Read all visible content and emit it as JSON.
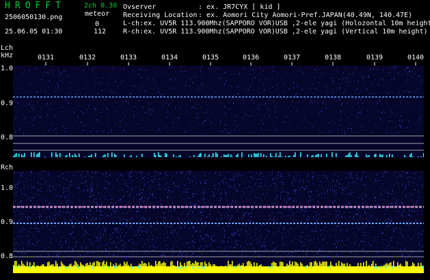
{
  "header": {
    "app_title": "HROFFT",
    "version": "2ch 0.30",
    "filename": "2506050130.png",
    "datetime": "25.06.05 01:30",
    "meteor_label": "meteor",
    "meteor_count_l": "0",
    "meteor_count_r": "112"
  },
  "info": {
    "observer_label": "Ovserver",
    "observer_value": ": ex. JR7CYX [ kid ]",
    "location_label": "Receiving Location",
    "location_value": ": ex. Aomori City Aomori-Pref.JAPAN(40.49N, 140.47E)",
    "lch_info": "L-ch:ex. UV5R 113.900Mhz(SAPPORO VOR)USB ,2-ele yagi (Holozontal 10m height)",
    "rch_info": "R-ch:ex. UV5R 113.900Mhz(SAPPORO VOR)USB ,2-ele yagi (Vertical 10m height)"
  },
  "channels": {
    "lch": "Lch",
    "khz": "kHz",
    "rch": "Rch"
  },
  "time_ticks": [
    "0131",
    "0132",
    "0133",
    "0134",
    "0135",
    "0136",
    "0137",
    "0138",
    "0139",
    "0140"
  ],
  "lch_axis": [
    "1.0",
    "0.9",
    "0.8"
  ],
  "rch_axis": [
    "1.0",
    "0.9",
    "0.8"
  ],
  "colors": {
    "title_green": "#00cc33",
    "background": "#000000",
    "noise": "#06062a",
    "signal_line": "#6fa8ff",
    "meteor_cyan": "#33ffff",
    "meteor_yellow": "#ffff00",
    "ref_line": "#d8d8d8"
  }
}
